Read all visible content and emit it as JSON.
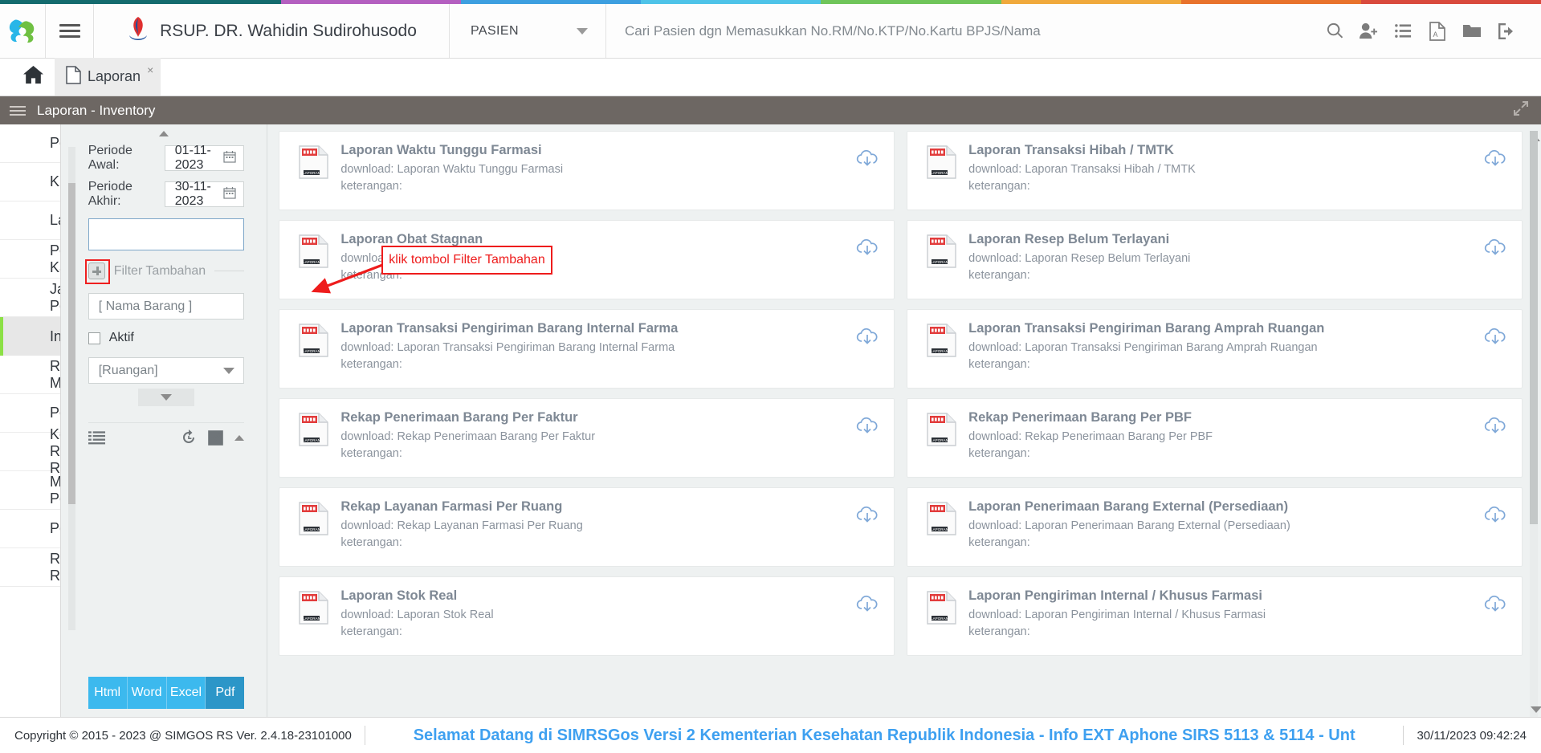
{
  "theme": {
    "accent_blue": "#3cb9ee",
    "accent_blue_active": "#2c96c8",
    "module_bar_bg": "#6d6763",
    "panel_bg": "#eef1f1",
    "active_sidebar_green": "#8ce046",
    "annotation_red": "#ee1c1c",
    "marquee_blue": "#3ea0f0",
    "rainbow": [
      "#146b6e",
      "#b45fc0",
      "#3d9fe0",
      "#4ec3e8",
      "#6fc55a",
      "#f0a93c",
      "#e8722c",
      "#d94a3d"
    ]
  },
  "header": {
    "logo_icon": "simrs-logo-icon",
    "menu_icon": "hamburger-menu-icon",
    "hospital_logo_icon": "hospital-crest-icon",
    "hospital_name": "RSUP. DR. Wahidin Sudirohusodo",
    "module_select": {
      "value": "PASIEN",
      "caret_icon": "chevron-down-icon"
    },
    "patient_search": {
      "value": "",
      "placeholder": "Cari Pasien dgn Memasukkan No.RM/No.KTP/No.Kartu BPJS/Nama"
    },
    "icons": [
      {
        "name": "search-icon",
        "label": "Cari"
      },
      {
        "name": "add-user-icon",
        "label": "Tambah Pasien"
      },
      {
        "name": "list-icon",
        "label": "Daftar"
      },
      {
        "name": "pdf-file-icon",
        "label": "PDF"
      },
      {
        "name": "folder-icon",
        "label": "Folder"
      },
      {
        "name": "logout-icon",
        "label": "Keluar"
      }
    ]
  },
  "tabs": {
    "home_icon": "home-icon",
    "items": [
      {
        "icon": "document-icon",
        "label": "Laporan",
        "close_label": "×",
        "active": true
      }
    ]
  },
  "module_bar": {
    "menu_icon": "hamburger-menu-icon",
    "title": "Laporan - Inventory",
    "expand_icon": "expand-diagonal-icon"
  },
  "sidebar": {
    "items": [
      {
        "label": "Pengunjung",
        "active": false
      },
      {
        "label": "Kunjungan",
        "active": false
      },
      {
        "label": "Layanan",
        "active": false
      },
      {
        "label": "Penerimaan Kasir",
        "active": false
      },
      {
        "label": "Jasa Pelayanan",
        "active": false
      },
      {
        "label": "Inventory",
        "active": true
      },
      {
        "label": "Rekam Medis",
        "active": false
      },
      {
        "label": "Pendapatan",
        "active": false
      },
      {
        "label": "Kegiatan RI dan RD",
        "active": false
      },
      {
        "label": "Monitoring Pelayanan",
        "active": false
      },
      {
        "label": "Pegawai",
        "active": false
      },
      {
        "label": "Risk Register",
        "active": false
      }
    ]
  },
  "filter_panel": {
    "collapse_top_icon": "chevron-up-icon",
    "periode_awal": {
      "label": "Periode Awal:",
      "value": "01-11-2023",
      "calendar_icon": "calendar-icon"
    },
    "periode_akhir": {
      "label": "Periode Akhir:",
      "value": "30-11-2023",
      "calendar_icon": "calendar-icon"
    },
    "blank_field": {
      "value": "",
      "placeholder": ""
    },
    "filter_tambahan": {
      "plus_icon": "plus-square-icon",
      "label": "Filter Tambahan",
      "highlighted": true
    },
    "nama_barang": {
      "value": "",
      "placeholder": "[ Nama Barang ]"
    },
    "aktif_checkbox": {
      "label": "Aktif",
      "checked": false
    },
    "ruangan_select": {
      "value": "[Ruangan]",
      "caret_icon": "chevron-down-icon"
    },
    "more_toggle_icon": "chevron-down-icon",
    "toolbar": {
      "list_icon": "list-bullet-icon",
      "history_icon": "history-rewind-icon",
      "checkbox_icon": "checkbox-checked-icon",
      "collapse_icon": "chevron-up-icon"
    },
    "export_buttons": [
      {
        "label": "Html",
        "active": false
      },
      {
        "label": "Word",
        "active": false
      },
      {
        "label": "Excel",
        "active": false
      },
      {
        "label": "Pdf",
        "active": true
      }
    ]
  },
  "annotation": {
    "text": "klik tombol Filter Tambahan",
    "arrow_icon": "arrow-pointer-icon"
  },
  "reports": {
    "download_prefix": "download:",
    "note_label": "keterangan:",
    "doc_icon": "report-document-icon",
    "doc_icon_text": "LAPORAN",
    "download_icon": "cloud-download-icon",
    "items": [
      {
        "title": "Laporan Waktu Tunggu Farmasi",
        "download": "download: Laporan Waktu Tunggu Farmasi",
        "note": "keterangan:"
      },
      {
        "title": "Laporan Transaksi Hibah / TMTK",
        "download": "download: Laporan Transaksi Hibah / TMTK",
        "note": "keterangan:"
      },
      {
        "title": "Laporan Obat Stagnan",
        "download": "download: Laporan Obat Stagnan",
        "note": "keterangan:"
      },
      {
        "title": "Laporan Resep Belum Terlayani",
        "download": "download: Laporan Resep Belum Terlayani",
        "note": "keterangan:"
      },
      {
        "title": "Laporan Transaksi Pengiriman Barang Internal Farma",
        "download": "download: Laporan Transaksi Pengiriman Barang Internal Farma",
        "note": "keterangan:"
      },
      {
        "title": "Laporan Transaksi Pengiriman Barang Amprah Ruangan",
        "download": "download: Laporan Transaksi Pengiriman Barang Amprah Ruangan",
        "note": "keterangan:"
      },
      {
        "title": "Rekap Penerimaan Barang Per Faktur",
        "download": "download: Rekap Penerimaan Barang Per Faktur",
        "note": "keterangan:"
      },
      {
        "title": "Rekap Penerimaan Barang Per PBF",
        "download": "download: Rekap Penerimaan Barang Per PBF",
        "note": "keterangan:"
      },
      {
        "title": "Rekap Layanan Farmasi Per Ruang",
        "download": "download: Rekap Layanan Farmasi Per Ruang",
        "note": "keterangan:"
      },
      {
        "title": "Laporan Penerimaan Barang External (Persediaan)",
        "download": "download: Laporan Penerimaan Barang External (Persediaan)",
        "note": "keterangan:"
      },
      {
        "title": "Laporan Stok Real",
        "download": "download: Laporan Stok Real",
        "note": "keterangan:"
      },
      {
        "title": "Laporan Pengiriman Internal / Khusus Farmasi",
        "download": "download: Laporan Pengiriman Internal / Khusus Farmasi",
        "note": "keterangan:"
      }
    ]
  },
  "footer": {
    "copyright": "Copyright © 2015 - 2023 @ SIMGOS RS Ver. 2.4.18-23101000",
    "marquee": "Selamat Datang di SIMRSGos Versi 2 Kementerian Kesehatan Republik Indonesia - Info EXT Aphone SIRS 5113 & 5114 - Unt",
    "datetime": "30/11/2023 09:42:24"
  }
}
